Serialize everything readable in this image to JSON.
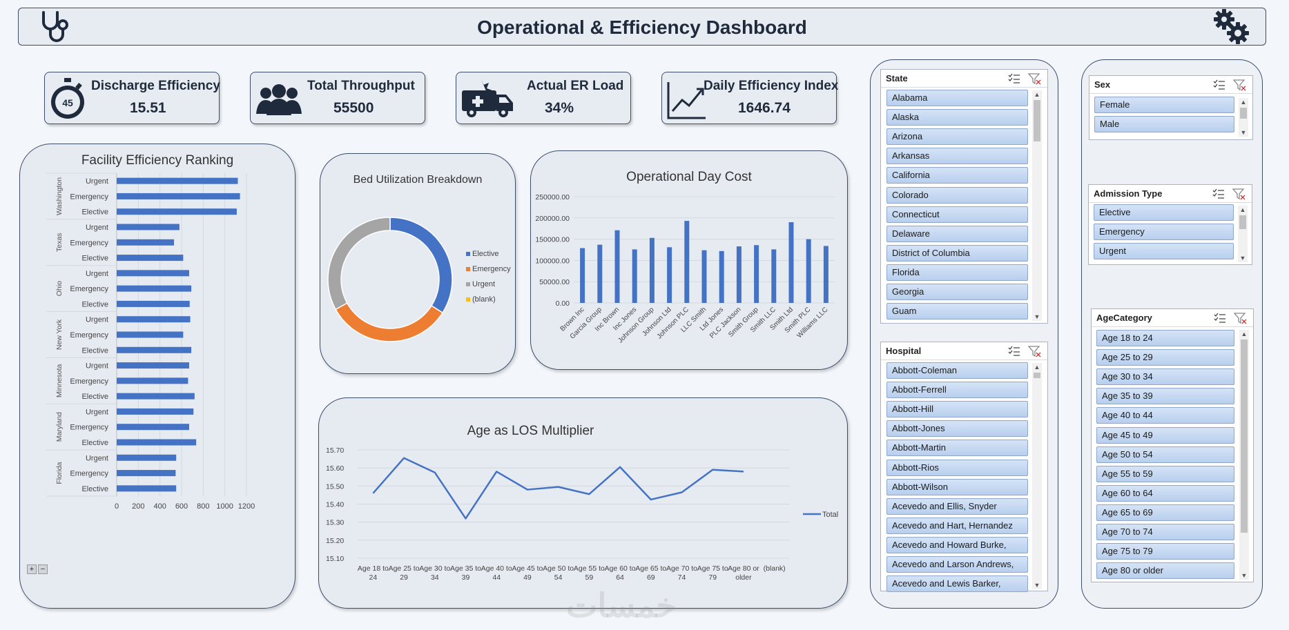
{
  "header": {
    "title": "Operational & Efficiency Dashboard",
    "left_icon": "stethoscope-icon",
    "right_icon": "gears-icon"
  },
  "kpis": [
    {
      "label": "Discharge Efficiency",
      "value": "15.51",
      "icon": "stopwatch-icon"
    },
    {
      "label": "Total Throughput",
      "value": "55500",
      "icon": "people-icon"
    },
    {
      "label": "Actual ER Load",
      "value": "34%",
      "icon": "ambulance-icon"
    },
    {
      "label": "Daily Efficiency Index",
      "value": "1646.74",
      "icon": "trend-up-icon"
    }
  ],
  "colors": {
    "blue": "#4472c4",
    "orange": "#ed7d31",
    "gray": "#a5a5a5",
    "yellow": "#ffc000",
    "border": "#3c4c6a"
  },
  "chart_data": [
    {
      "type": "bar",
      "title": "Facility Efficiency Ranking",
      "orientation": "horizontal",
      "groups": [
        "Washington",
        "Texas",
        "Ohio",
        "New York",
        "Minnesota",
        "Maryland",
        "Florida"
      ],
      "subcategories": [
        "Urgent",
        "Emergency",
        "Elective"
      ],
      "values": [
        [
          1120,
          1140,
          1110
        ],
        [
          580,
          530,
          615
        ],
        [
          670,
          690,
          675
        ],
        [
          680,
          615,
          690
        ],
        [
          670,
          660,
          720
        ],
        [
          710,
          670,
          735
        ],
        [
          550,
          545,
          550
        ]
      ],
      "xticks": [
        "0",
        "200",
        "400",
        "600",
        "800",
        "1000",
        "1200"
      ],
      "xlim": [
        0,
        1200
      ],
      "grid": true,
      "expand_buttons": [
        "+",
        "−"
      ]
    },
    {
      "type": "pie",
      "title": "Bed Utilization Breakdown",
      "donut": true,
      "labels": [
        "Elective",
        "Emergency",
        "Urgent",
        "(blank)"
      ],
      "values": [
        34,
        33,
        33,
        0
      ],
      "colors": [
        "#4472c4",
        "#ed7d31",
        "#a5a5a5",
        "#ffc000"
      ],
      "legend": "right"
    },
    {
      "type": "bar",
      "title": "Operational Day Cost",
      "categories": [
        "Brown Inc",
        "Garcia Group",
        "Inc Brown",
        "Inc Jones",
        "Johnson Group",
        "Johnson Ltd",
        "Johnson PLC",
        "LLC Smith",
        "Ltd Jones",
        "PLC Jackson",
        "Smith Group",
        "Smith LLC",
        "Smith Ltd",
        "Smith PLC",
        "Williams LLC"
      ],
      "values": [
        129000,
        137000,
        171000,
        126000,
        153000,
        131000,
        193000,
        124000,
        122000,
        133000,
        136000,
        126000,
        190000,
        150000,
        134000
      ],
      "yticks": [
        "0.00",
        "50000.00",
        "100000.00",
        "150000.00",
        "200000.00",
        "250000.00"
      ],
      "ylim": [
        0,
        250000
      ],
      "grid": true
    },
    {
      "type": "line",
      "title": "Age as LOS Multiplier",
      "categories": [
        "Age 18 to 24",
        "Age 25 to 29",
        "Age 30 to 34",
        "Age 35 to 39",
        "Age 40 to 44",
        "Age 45 to 49",
        "Age 50 to 54",
        "Age 55 to 59",
        "Age 60 to 64",
        "Age 65 to 69",
        "Age 70 to 74",
        "Age 75 to 79",
        "Age 80 or older",
        "(blank)"
      ],
      "category_lines": [
        [
          "Age 18 to",
          "24"
        ],
        [
          "Age 25 to",
          "29"
        ],
        [
          "Age 30 to",
          "34"
        ],
        [
          "Age 35 to",
          "39"
        ],
        [
          "Age 40 to",
          "44"
        ],
        [
          "Age 45 to",
          "49"
        ],
        [
          "Age 50 to",
          "54"
        ],
        [
          "Age 55 to",
          "59"
        ],
        [
          "Age 60 to",
          "64"
        ],
        [
          "Age 65 to",
          "69"
        ],
        [
          "Age 70 to",
          "74"
        ],
        [
          "Age 75 to",
          "79"
        ],
        [
          "Age 80 or",
          "older"
        ],
        [
          "(blank)",
          ""
        ]
      ],
      "series": [
        {
          "name": "Total",
          "values": [
            15.46,
            15.655,
            15.575,
            15.32,
            15.58,
            15.48,
            15.495,
            15.455,
            15.605,
            15.425,
            15.465,
            15.59,
            15.58,
            null
          ]
        }
      ],
      "yticks": [
        "15.10",
        "15.20",
        "15.30",
        "15.40",
        "15.50",
        "15.60",
        "15.70"
      ],
      "ylim": [
        15.1,
        15.7
      ],
      "grid": true,
      "legend": "right"
    }
  ],
  "slicers": {
    "state": {
      "title": "State",
      "items": [
        "Alabama",
        "Alaska",
        "Arizona",
        "Arkansas",
        "California",
        "Colorado",
        "Connecticut",
        "Delaware",
        "District of Columbia",
        "Florida",
        "Georgia",
        "Guam"
      ]
    },
    "hospital": {
      "title": "Hospital",
      "items": [
        "Abbott-Coleman",
        "Abbott-Ferrell",
        "Abbott-Hill",
        "Abbott-Jones",
        "Abbott-Martin",
        "Abbott-Rios",
        "Abbott-Wilson",
        "Acevedo and Ellis, Snyder",
        "Acevedo and Hart, Hernandez",
        "Acevedo and Howard Burke,",
        "Acevedo and Larson Andrews,",
        "Acevedo and Lewis Barker,"
      ]
    },
    "sex": {
      "title": "Sex",
      "items": [
        "Female",
        "Male"
      ]
    },
    "admission": {
      "title": "Admission Type",
      "items": [
        "Elective",
        "Emergency",
        "Urgent"
      ]
    },
    "age": {
      "title": "AgeCategory",
      "items": [
        "Age 18 to 24",
        "Age 25 to 29",
        "Age 30 to 34",
        "Age 35 to 39",
        "Age 40 to 44",
        "Age 45 to 49",
        "Age 50 to 54",
        "Age 55 to 59",
        "Age 60 to 64",
        "Age 65 to 69",
        "Age 70 to 74",
        "Age 75 to 79",
        "Age 80 or older"
      ]
    }
  },
  "watermark": "خمسات"
}
